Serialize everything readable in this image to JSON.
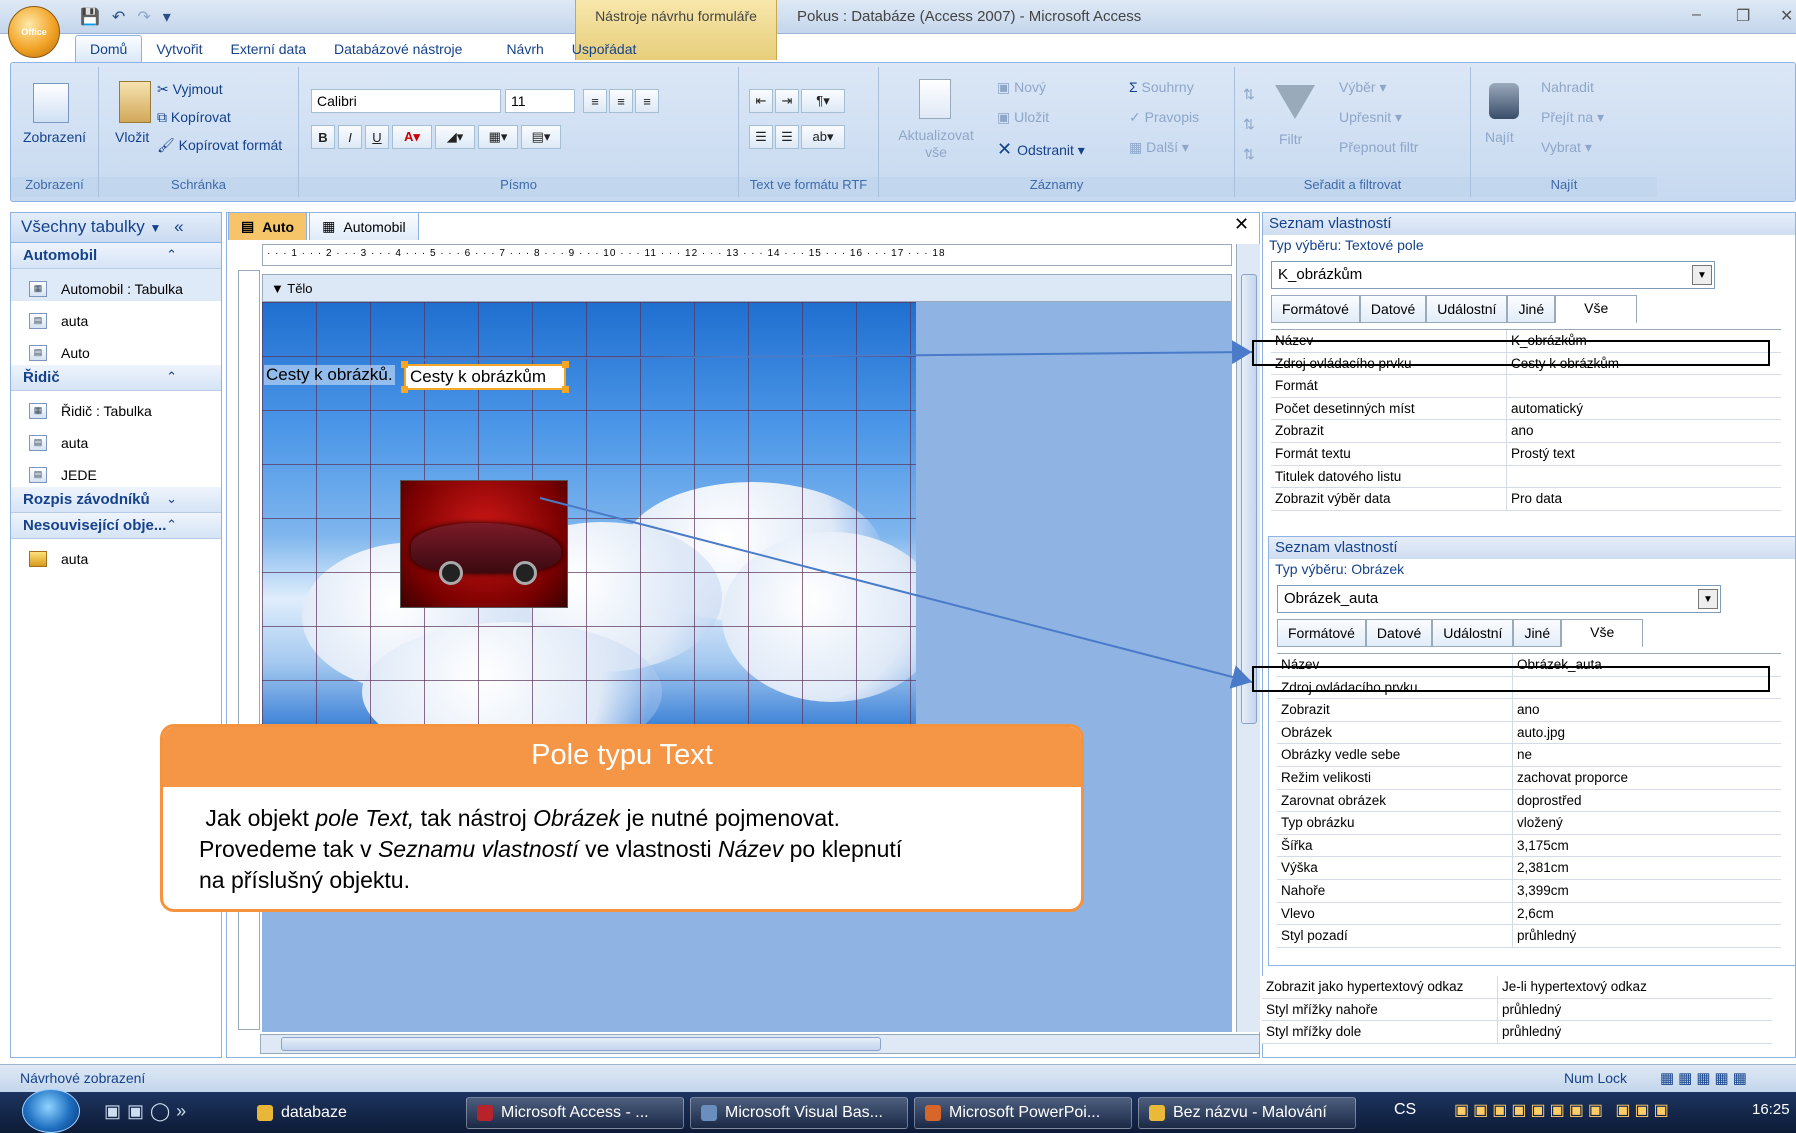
{
  "window": {
    "contextual_title": "Nástroje návrhu formuláře",
    "title": "Pokus : Databáze (Access 2007) - Microsoft Access",
    "office_button": "Office"
  },
  "tabs": [
    "Domů",
    "Vytvořit",
    "Externí data",
    "Databázové nástroje",
    "Návrh",
    "Uspořádat"
  ],
  "ribbon": {
    "views": {
      "button": "Zobrazení",
      "group": "Zobrazení"
    },
    "clipboard": {
      "paste": "Vložit",
      "cut": "Vyjmout",
      "copy": "Kopírovat",
      "format_painter": "Kopírovat formát",
      "group": "Schránka"
    },
    "font": {
      "family": "Calibri",
      "size": "11",
      "bold": "B",
      "italic": "I",
      "underline": "U",
      "group": "Písmo"
    },
    "rtf": {
      "group": "Text ve formátu RTF"
    },
    "records": {
      "refresh": "Aktualizovat vše",
      "new": "Nový",
      "save": "Uložit",
      "delete": "Odstranit",
      "totals": "Souhrny",
      "spelling": "Pravopis",
      "more": "Další",
      "group": "Záznamy"
    },
    "sort": {
      "filter": "Filtr",
      "selection": "Výběr",
      "advanced": "Upřesnit",
      "toggle": "Přepnout filtr",
      "group": "Seřadit a filtrovat"
    },
    "find": {
      "find": "Najít",
      "replace": "Nahradit",
      "goto": "Přejít na",
      "select": "Vybrat",
      "group": "Najít"
    }
  },
  "nav": {
    "title": "Všechny tabulky",
    "groups": [
      {
        "name": "Automobil",
        "items": [
          {
            "label": "Automobil : Tabulka",
            "kind": "table"
          },
          {
            "label": "auta",
            "kind": "form"
          },
          {
            "label": "Auto",
            "kind": "form"
          }
        ]
      },
      {
        "name": "Řidič",
        "items": [
          {
            "label": "Řidič : Tabulka",
            "kind": "table"
          },
          {
            "label": "auta",
            "kind": "form"
          },
          {
            "label": "JEDE",
            "kind": "form"
          }
        ]
      },
      {
        "name": "Rozpis závodníků",
        "items": []
      },
      {
        "name": "Nesouvisející obje...",
        "items": [
          {
            "label": "auta",
            "kind": "query"
          }
        ]
      }
    ]
  },
  "doc_tabs": [
    "Auto",
    "Automobil"
  ],
  "form": {
    "section": "Tělo",
    "label_text": "Cesty k obrázků.",
    "textbox_value": "Cesty k obrázkům",
    "ruler_marks": "· · · 1 · · · 2 · · · 3 · · · 4 · · · 5 · · · 6 · · · 7 · · · 8 · · · 9 · · · 10 · · · 11 · · · 12 · · · 13 · · · 14 · · · 15 · · · 16 · · · 17 · · · 18"
  },
  "callout": {
    "title": "Pole typu Text",
    "line1_a": "Jak objekt ",
    "line1_b": "pole Text,",
    "line1_c": " tak nástroj ",
    "line1_d": "Obrázek",
    "line1_e": " je nutné pojmenovat.",
    "line2_a": "Provedeme  tak v ",
    "line2_b": "Seznamu vlastností",
    "line2_c": " ve vlastnosti ",
    "line2_d": "Název",
    "line2_e": " po klepnutí",
    "line3": "na příslušný objektu."
  },
  "props1": {
    "title": "Seznam vlastností",
    "type": "Typ výběru:  Textové pole",
    "combo": "K_obrázkům",
    "tabs": [
      "Formátové",
      "Datové",
      "Událostní",
      "Jiné",
      "Vše"
    ],
    "rows": [
      [
        "Název",
        "K_obrázkům"
      ],
      [
        "Zdroj ovládacího prvku",
        "Cesty k obrázkům"
      ],
      [
        "Formát",
        ""
      ],
      [
        "Počet desetinných míst",
        "automatický"
      ],
      [
        "Zobrazit",
        "ano"
      ],
      [
        "Formát textu",
        "Prostý text"
      ],
      [
        "Titulek datového listu",
        ""
      ],
      [
        "Zobrazit výběr data",
        "Pro data"
      ]
    ],
    "extra_rows": [
      [
        "Zobrazit jako hypertextový odkaz",
        "Je-li hypertextový odkaz"
      ],
      [
        "Styl mřížky nahoře",
        "průhledný"
      ],
      [
        "Styl mřížky dole",
        "průhledný"
      ]
    ]
  },
  "props2": {
    "title": "Seznam vlastností",
    "type": "Typ výběru:  Obrázek",
    "combo": "Obrázek_auta",
    "tabs": [
      "Formátové",
      "Datové",
      "Událostní",
      "Jiné",
      "Vše"
    ],
    "rows": [
      [
        "Název",
        "Obrázek_auta"
      ],
      [
        "Zdroj ovládacího prvku",
        ""
      ],
      [
        "Zobrazit",
        "ano"
      ],
      [
        "Obrázek",
        "auto.jpg"
      ],
      [
        "Obrázky vedle sebe",
        "ne"
      ],
      [
        "Režim velikosti",
        "zachovat proporce"
      ],
      [
        "Zarovnat obrázek",
        "doprostřed"
      ],
      [
        "Typ obrázku",
        "vložený"
      ],
      [
        "Šířka",
        "3,175cm"
      ],
      [
        "Výška",
        "2,381cm"
      ],
      [
        "Nahoře",
        "3,399cm"
      ],
      [
        "Vlevo",
        "2,6cm"
      ],
      [
        "Styl pozadí",
        "průhledný"
      ]
    ]
  },
  "status": {
    "left": "Návrhové zobrazení",
    "numlock": "Num Lock"
  },
  "taskbar": {
    "items": [
      "databaze",
      "Microsoft Access - ...",
      "Microsoft Visual Bas...",
      "Microsoft PowerPoi...",
      "Bez názvu - Malování"
    ],
    "lang": "CS",
    "clock": "16:25"
  },
  "colors": {
    "accent": "#f59646",
    "ribbon": "#c7d9f0",
    "highlight": "#000000"
  }
}
